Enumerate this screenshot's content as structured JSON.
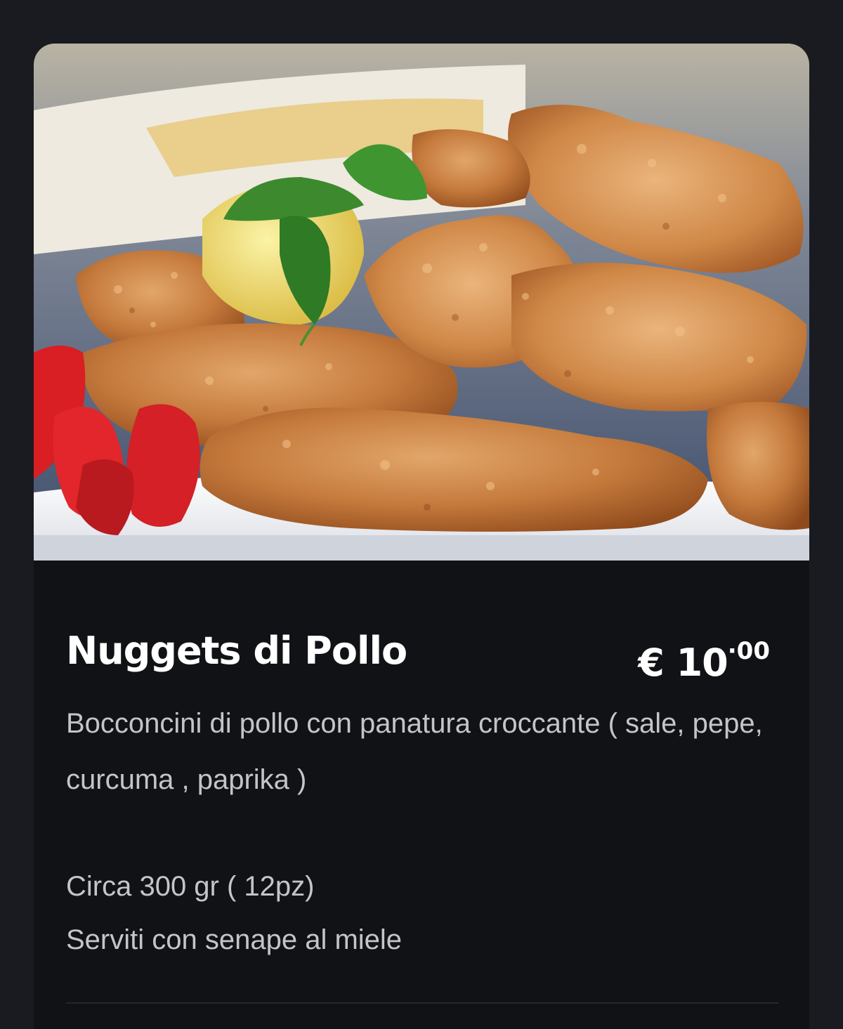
{
  "item": {
    "name": "Nuggets di Pollo",
    "price_main": "€ 10",
    "price_cents": "·00",
    "description": "Bocconcini di pollo con panatura croccante ( sale, pepe, curcuma , paprika )",
    "details": [
      "Circa 300 gr ( 12pz)",
      "Serviti con senape al miele"
    ],
    "photo_icon": "food-photo-chicken-nuggets"
  },
  "colors": {
    "page_background": "#1a1b20",
    "card_background": "#111215",
    "title_text": "#ffffff",
    "body_text": "#c4c5ca",
    "divider": "#24262c"
  }
}
